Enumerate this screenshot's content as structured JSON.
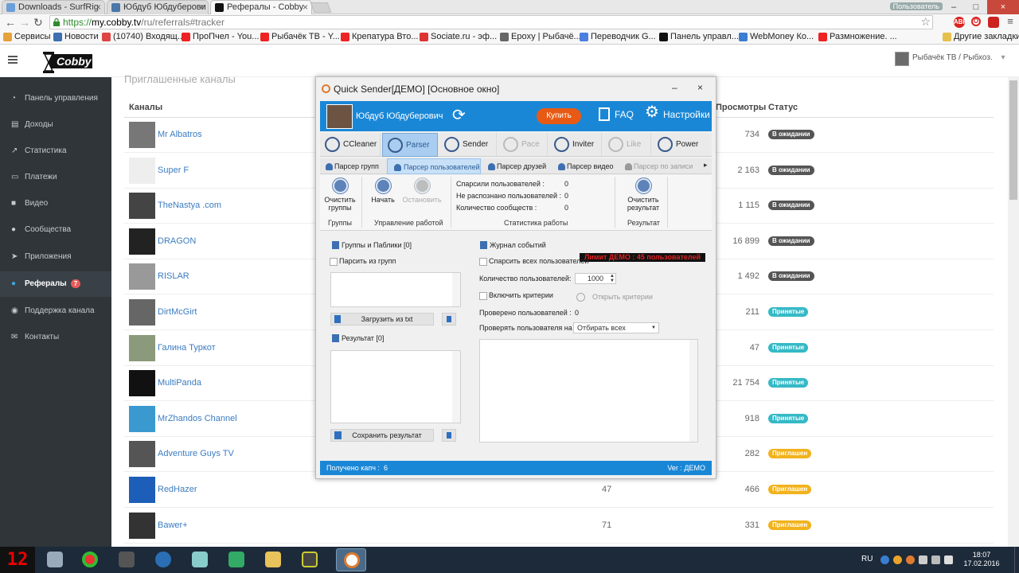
{
  "browser": {
    "tabs": [
      {
        "title": "Downloads - SurfRig",
        "active": false
      },
      {
        "title": "Юбдуб Юбдуберови",
        "active": false
      },
      {
        "title": "Рефералы - Cobby",
        "active": true
      }
    ],
    "user_badge": "Пользователь",
    "url_scheme": "https://",
    "url_host": "my.cobby.tv",
    "url_path": "/ru/referrals#tracker",
    "bookmarks": [
      {
        "label": "Сервисы",
        "icon": "apps-icon",
        "color": "#e5a23a"
      },
      {
        "label": "Новости",
        "icon": "news-icon",
        "color": "#3d6fb1"
      },
      {
        "label": "(10740) Входящ...",
        "icon": "mail-icon",
        "color": "#d44"
      },
      {
        "label": "ПроПчел - You...",
        "icon": "youtube-icon",
        "color": "#e22"
      },
      {
        "label": "Рыбачёк ТВ - Y...",
        "icon": "youtube-icon",
        "color": "#e22"
      },
      {
        "label": "Крепатура Вто...",
        "icon": "youtube-icon",
        "color": "#e22"
      },
      {
        "label": "Sociate.ru - эф...",
        "icon": "sociate-icon",
        "color": "#d33"
      },
      {
        "label": "Epoxy | Рыбачё...",
        "icon": "epoxy-icon",
        "color": "#666"
      },
      {
        "label": "Переводчик G...",
        "icon": "translate-icon",
        "color": "#4a7fe0"
      },
      {
        "label": "Панель управл...",
        "icon": "cobby-icon",
        "color": "#111"
      },
      {
        "label": "WebMoney Ко...",
        "icon": "webmoney-icon",
        "color": "#3a7ed1"
      },
      {
        "label": "Размножение. ...",
        "icon": "youtube-icon",
        "color": "#e22"
      }
    ],
    "other_bookmarks": "Другие закладки"
  },
  "site": {
    "logo": "Cobby",
    "profile_name": "Рыбачёк ТВ / Рыбхоз.",
    "sidebar": [
      {
        "label": "Панель управления",
        "icon": "dashboard-icon",
        "active": false
      },
      {
        "label": "Доходы",
        "icon": "income-icon",
        "active": false
      },
      {
        "label": "Статистика",
        "icon": "stats-icon",
        "active": false
      },
      {
        "label": "Платежи",
        "icon": "payments-icon",
        "active": false
      },
      {
        "label": "Видео",
        "icon": "video-icon",
        "active": false
      },
      {
        "label": "Сообщества",
        "icon": "communities-icon",
        "active": false
      },
      {
        "label": "Приложения",
        "icon": "apps-icon",
        "active": false
      },
      {
        "label": "Рефералы",
        "icon": "referrals-icon",
        "active": true,
        "badge": "7"
      },
      {
        "label": "Поддержка канала",
        "icon": "support-icon",
        "active": false
      },
      {
        "label": "Контакты",
        "icon": "contacts-icon",
        "active": false
      }
    ],
    "section_title": "Приглашенные каналы",
    "columns": {
      "channels": "Каналы",
      "views": "Просмотры",
      "status": "Статус"
    },
    "rows": [
      {
        "name": "Mr Albatros",
        "hits": "",
        "views": "734",
        "status": "В ожидании",
        "color": "#555",
        "avatar": "#777"
      },
      {
        "name": "Super F",
        "hits": "",
        "views": "2 163",
        "status": "В ожидании",
        "color": "#555",
        "avatar": "#eee"
      },
      {
        "name": "TheNastya .com",
        "hits": "",
        "views": "1 115",
        "status": "В ожидании",
        "color": "#555",
        "avatar": "#444"
      },
      {
        "name": "DRAGON",
        "hits": "",
        "views": "16 899",
        "status": "В ожидании",
        "color": "#555",
        "avatar": "#222"
      },
      {
        "name": "RISLAR",
        "hits": "",
        "views": "1 492",
        "status": "В ожидании",
        "color": "#555",
        "avatar": "#999"
      },
      {
        "name": "DirtMcGirt",
        "hits": "",
        "views": "211",
        "status": "Принятые",
        "color": "#35b9c6",
        "avatar": "#666"
      },
      {
        "name": "Галина Туркот",
        "hits": "",
        "views": "47",
        "status": "Принятые",
        "color": "#35b9c6",
        "avatar": "#8a9a7a"
      },
      {
        "name": "MultiPanda",
        "hits": "",
        "views": "21 754",
        "status": "Принятые",
        "color": "#35b9c6",
        "avatar": "#111"
      },
      {
        "name": "MrZhandos Channel",
        "hits": "",
        "views": "918",
        "status": "Принятые",
        "color": "#35b9c6",
        "avatar": "#3a9ad0"
      },
      {
        "name": "Adventure Guys TV",
        "hits": "",
        "views": "282",
        "status": "Приглашен",
        "color": "#f2b21c",
        "avatar": "#555"
      },
      {
        "name": "RedHazer",
        "hits": "47",
        "views": "466",
        "status": "Приглашен",
        "color": "#f2b21c",
        "avatar": "#1d5fb8"
      },
      {
        "name": "Bawer+",
        "hits": "71",
        "views": "331",
        "status": "Приглашен",
        "color": "#f2b21c",
        "avatar": "#333"
      }
    ]
  },
  "qs": {
    "title": "Quick Sender[ДЕМО] [Основное окно]",
    "minimize": "–",
    "close": "×",
    "user_name": "Юбдуб Юбдуберович",
    "buy": "Купить",
    "faq": "FAQ",
    "settings": "Настройки",
    "modules": [
      {
        "label": "CCleaner",
        "state": "normal"
      },
      {
        "label": "Parser",
        "state": "active"
      },
      {
        "label": "Sender",
        "state": "normal"
      },
      {
        "label": "Pace",
        "state": "disabled"
      },
      {
        "label": "Inviter",
        "state": "normal"
      },
      {
        "label": "Like",
        "state": "disabled"
      },
      {
        "label": "Power",
        "state": "normal"
      }
    ],
    "subtabs": [
      {
        "label": "Парсер групп",
        "state": "normal"
      },
      {
        "label": "Парсер пользователей",
        "state": "active"
      },
      {
        "label": "Парсер друзей",
        "state": "normal"
      },
      {
        "label": "Парсер видео",
        "state": "normal"
      },
      {
        "label": "Парсер по записи",
        "state": "disabled"
      }
    ],
    "ribbon": {
      "clear_groups_1": "Очистить",
      "clear_groups_2": "группы",
      "start": "Начать",
      "stop": "Остановить",
      "group_groups": "Группы",
      "group_control": "Управление работой",
      "stat_parsed": "Спарсили пользователей :",
      "stat_parsed_val": "0",
      "stat_unrec": "Не распознано пользователей :",
      "stat_unrec_val": "0",
      "stat_comm": "Количество сообществ :",
      "stat_comm_val": "0",
      "group_stats": "Статистика работы",
      "clear_result_1": "Очистить",
      "clear_result_2": "результат",
      "group_result": "Результат"
    },
    "left": {
      "groups_title": "Группы и Паблики [0]",
      "parse_from_groups": "Парсить из групп",
      "load_txt": "Загрузить из txt",
      "result_title": "Результат [0]",
      "save_result": "Сохранить результат"
    },
    "right": {
      "log_title": "Журнал событий",
      "demo_limit": "Лимит ДЕМО : 45 пользователей",
      "parse_all": "Спарсить всех пользователей",
      "qty_label": "Количество пользователей:",
      "qty_value": "1000",
      "enable_criteria": "Включить критерии",
      "open_criteria": "Открыть критерии",
      "checked_label": "Проверено пользователей :",
      "checked_value": "0",
      "check_label": "Проверять пользователя на :",
      "check_value": "Отбирать всех"
    },
    "status": {
      "captcha_label": "Получено капч :",
      "captcha_value": "6",
      "version": "Ver : ДЕМО"
    }
  },
  "taskbar": {
    "start_label": "12",
    "lang": "RU",
    "time": "18:07",
    "date": "17.02.2016"
  }
}
